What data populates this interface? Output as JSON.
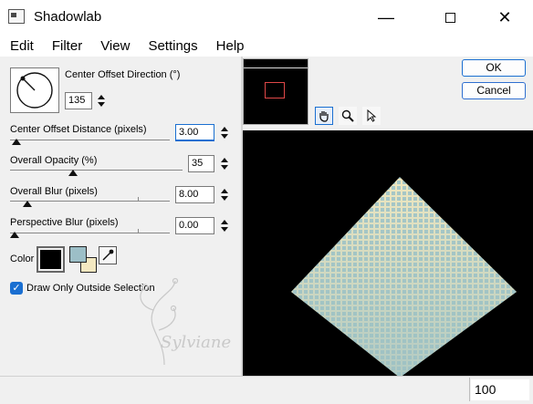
{
  "window": {
    "title": "Shadowlab"
  },
  "menu": [
    "Edit",
    "Filter",
    "View",
    "Settings",
    "Help"
  ],
  "controls": {
    "direction": {
      "label": "Center Offset Direction (°)",
      "value": "135"
    },
    "distance": {
      "label": "Center Offset Distance (pixels)",
      "value": "3.00"
    },
    "opacity": {
      "label": "Overall Opacity (%)",
      "value": "35"
    },
    "blur": {
      "label": "Overall Blur (pixels)",
      "value": "8.00"
    },
    "perspective_blur": {
      "label": "Perspective Blur (pixels)",
      "value": "0.00"
    },
    "color": {
      "label": "Color",
      "swatch_color": "#000000",
      "fg_color": "#9cbfc7",
      "bg_color": "#f4e9c1"
    },
    "draw_outside": {
      "label": "Draw Only Outside Selection",
      "checked": true
    }
  },
  "buttons": {
    "ok": "OK",
    "cancel": "Cancel"
  },
  "tools": [
    "hand-icon",
    "zoom-icon",
    "arrow-icon"
  ],
  "preview": {
    "accent": "#e04848"
  },
  "watermark": {
    "text": "Sylviane"
  },
  "status": {
    "zoom": "100"
  }
}
